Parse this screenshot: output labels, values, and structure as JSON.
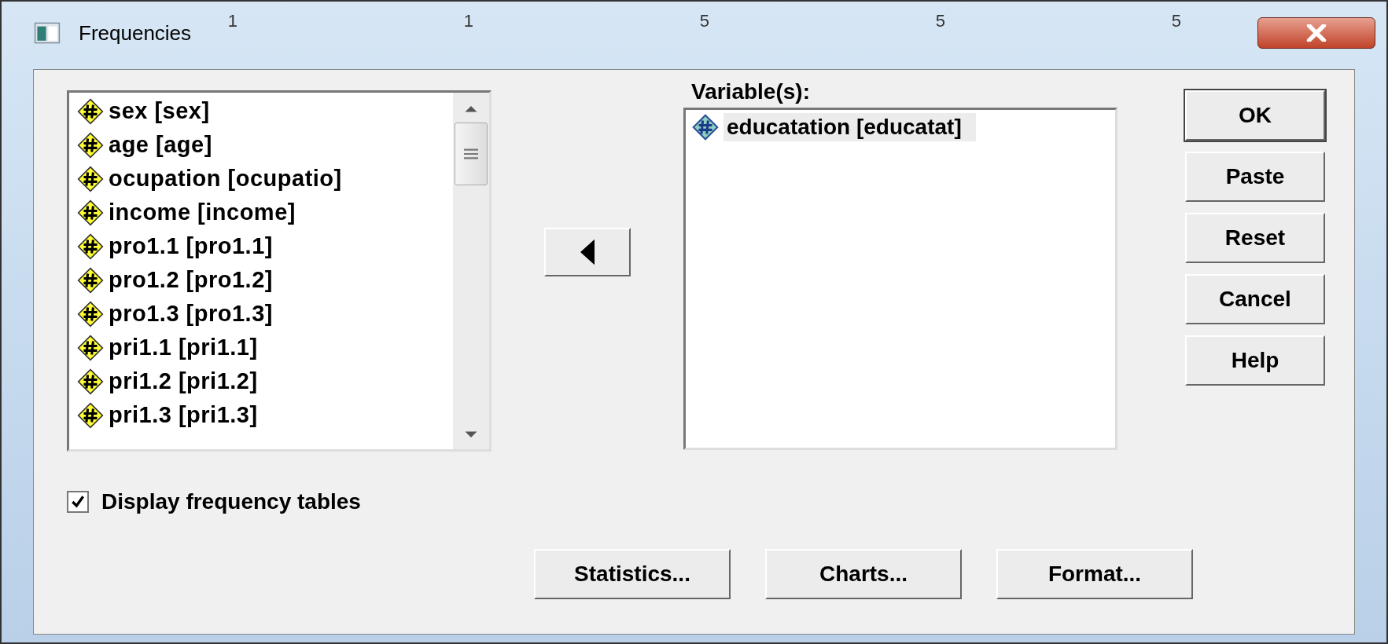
{
  "window": {
    "title": "Frequencies"
  },
  "background_column_labels": [
    "1",
    "1",
    "5",
    "5",
    "5"
  ],
  "source_list": {
    "items": [
      {
        "label": "sex [sex]"
      },
      {
        "label": "age [age]"
      },
      {
        "label": "ocupation [ocupatio]"
      },
      {
        "label": "income [income]"
      },
      {
        "label": "pro1.1 [pro1.1]"
      },
      {
        "label": "pro1.2 [pro1.2]"
      },
      {
        "label": "pro1.3 [pro1.3]"
      },
      {
        "label": "pri1.1 [pri1.1]"
      },
      {
        "label": "pri1.2 [pri1.2]"
      },
      {
        "label": "pri1.3 [pri1.3]"
      }
    ]
  },
  "variables": {
    "label": "Variable(s):",
    "items": [
      {
        "label": "educatation [educatat]",
        "selected": true
      }
    ]
  },
  "side_buttons": [
    {
      "label": "OK",
      "default": true
    },
    {
      "label": "Paste",
      "default": false
    },
    {
      "label": "Reset",
      "default": false
    },
    {
      "label": "Cancel",
      "default": false
    },
    {
      "label": "Help",
      "default": false
    }
  ],
  "display_frequency_tables": {
    "label": "Display frequency tables",
    "checked": true
  },
  "bottom_buttons": [
    "Statistics...",
    "Charts...",
    "Format..."
  ]
}
